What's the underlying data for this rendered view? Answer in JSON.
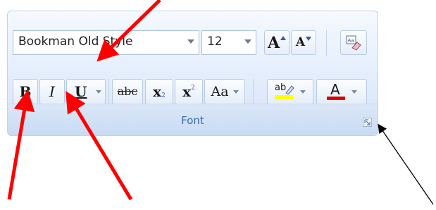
{
  "font_group": {
    "font_name": "Bookman Old Style",
    "font_size": "12",
    "grow_font": "A",
    "shrink_font": "A",
    "bold": "B",
    "italic": "I",
    "underline": "U",
    "strikethrough": "abc",
    "subscript_base": "x",
    "subscript_mark": "2",
    "superscript_base": "x",
    "superscript_mark": "2",
    "change_case": "Aa",
    "highlight_text": "ab",
    "font_color": "A",
    "group_label": "Font"
  },
  "colors": {
    "highlight": "#ffff00",
    "font_color_bar": "#e00000",
    "annotation_arrows": "#ff0000",
    "black_arrow": "#000000"
  }
}
